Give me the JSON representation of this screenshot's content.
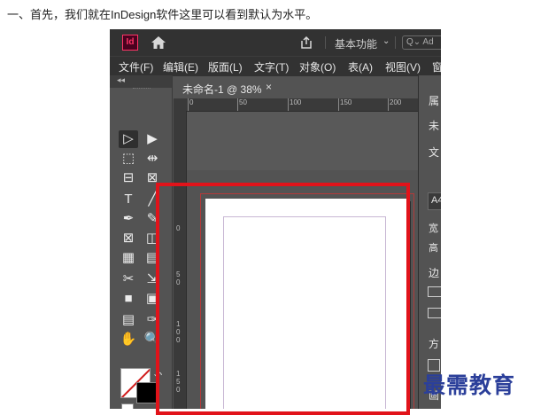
{
  "intro_text": "一、首先，我们就在InDesign软件这里可以看到默认为水平。",
  "app": {
    "logo_text": "Id",
    "workspace_label": "基本功能",
    "search_placeholder": "Ad",
    "menu": [
      "文件(F)",
      "编辑(E)",
      "版面(L)",
      "文字(T)",
      "对象(O)",
      "表(A)",
      "视图(V)",
      "窗"
    ],
    "tools_panel_arrow": "◂◂",
    "document_tab": {
      "title": "未命名-1 @ 38%",
      "close": "×"
    },
    "ruler_top_labels": [
      "0",
      "50",
      "100",
      "150",
      "200"
    ],
    "ruler_left_labels": [
      "0",
      "5",
      "0",
      "1",
      "0",
      "0",
      "1",
      "5",
      "0"
    ],
    "right_panel_labels": [
      "属",
      "未",
      "文",
      "A4",
      "宽",
      "高",
      "边",
      "方",
      "画"
    ],
    "tool_glyphs": [
      "▷",
      "▶",
      "⬚",
      "⇹",
      "⊟",
      "⊠",
      "T",
      "╱",
      "✒",
      "✎",
      "⊠",
      "◫",
      "▦",
      "▤",
      "✂",
      "⇲",
      "■",
      "▣",
      "▤",
      "✑",
      "✋",
      "🔍",
      "",
      ""
    ]
  },
  "watermark": "最需教育",
  "colors": {
    "highlight": "#e1131a",
    "app_dark": "#323232",
    "app_panel": "#535353",
    "watermark": "#2b3f9a"
  }
}
